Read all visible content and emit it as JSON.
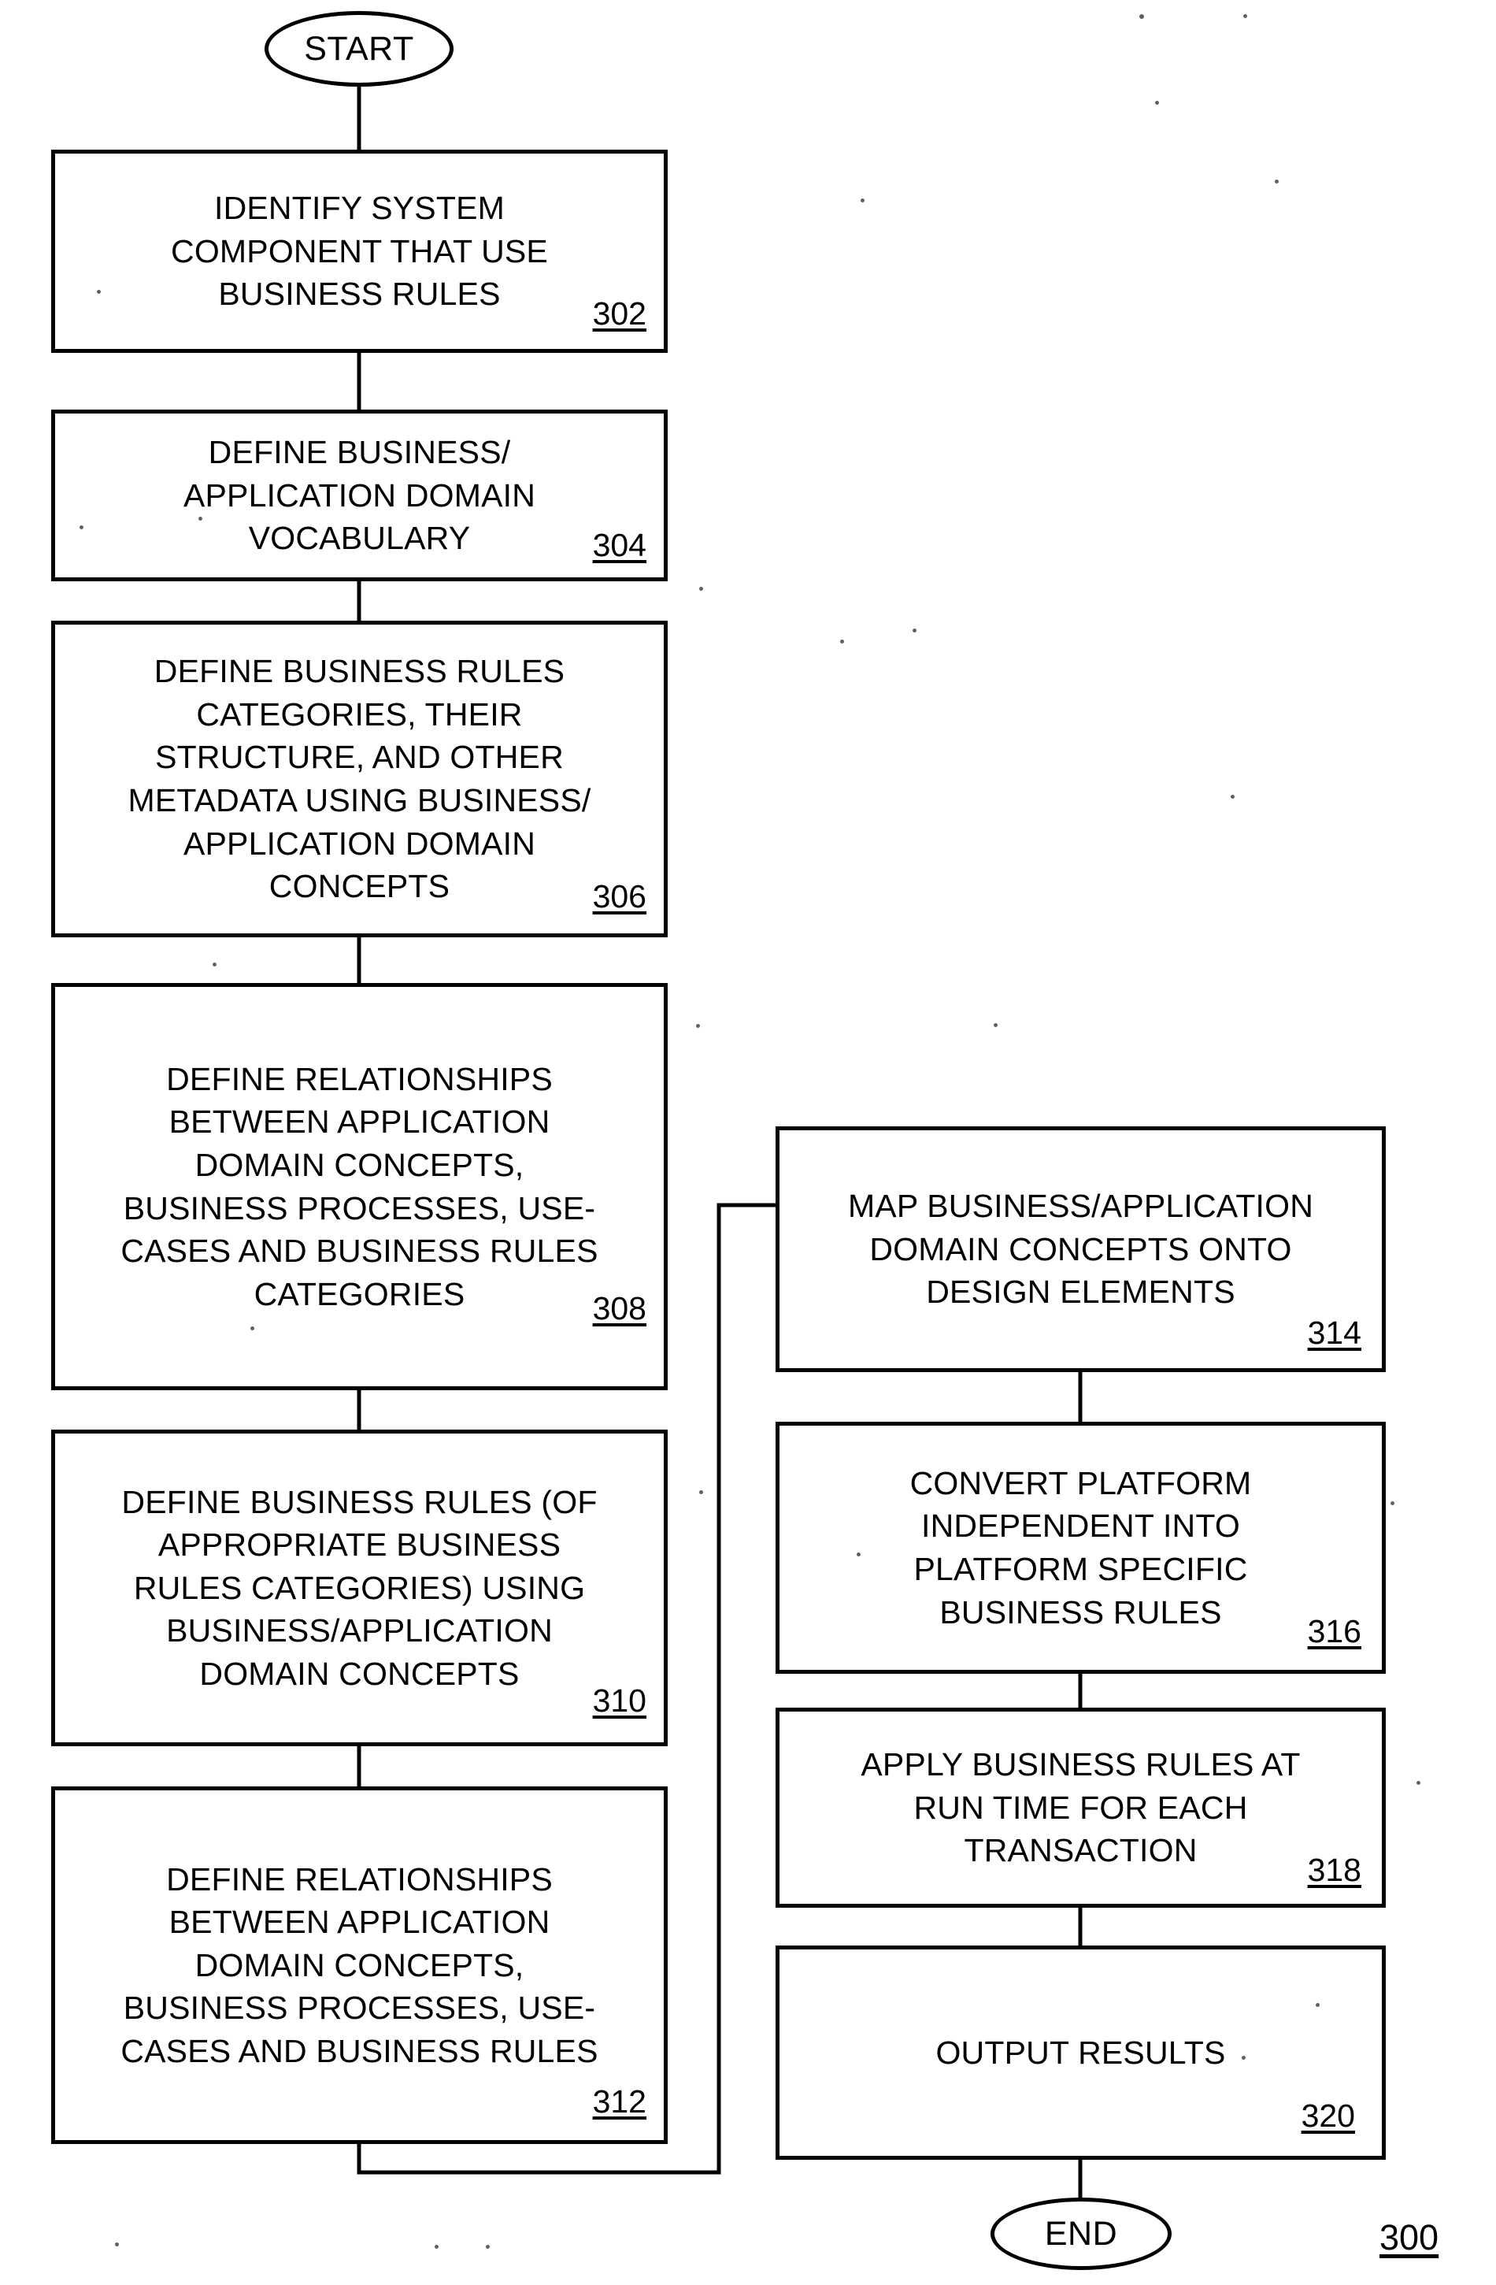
{
  "figure": {
    "number": "300",
    "start_label": "START",
    "end_label": "END"
  },
  "nodes": [
    {
      "id": "step-302",
      "ref": "302",
      "text": "IDENTIFY SYSTEM\nCOMPONENT THAT USE\nBUSINESS RULES",
      "column": "left"
    },
    {
      "id": "step-304",
      "ref": "304",
      "text": "DEFINE BUSINESS/\nAPPLICATION DOMAIN\nVOCABULARY",
      "column": "left"
    },
    {
      "id": "step-306",
      "ref": "306",
      "text": "DEFINE BUSINESS RULES\nCATEGORIES, THEIR\nSTRUCTURE, AND OTHER\nMETADATA USING BUSINESS/\nAPPLICATION DOMAIN\nCONCEPTS",
      "column": "left"
    },
    {
      "id": "step-308",
      "ref": "308",
      "text": "DEFINE RELATIONSHIPS\nBETWEEN APPLICATION\nDOMAIN CONCEPTS,\nBUSINESS PROCESSES, USE-\nCASES AND BUSINESS RULES\nCATEGORIES",
      "column": "left"
    },
    {
      "id": "step-310",
      "ref": "310",
      "text": "DEFINE BUSINESS RULES (OF\nAPPROPRIATE BUSINESS\nRULES CATEGORIES) USING\nBUSINESS/APPLICATION\nDOMAIN CONCEPTS",
      "column": "left"
    },
    {
      "id": "step-312",
      "ref": "312",
      "text": "DEFINE RELATIONSHIPS\nBETWEEN APPLICATION\nDOMAIN CONCEPTS,\nBUSINESS PROCESSES, USE-\nCASES AND BUSINESS RULES",
      "column": "left"
    },
    {
      "id": "step-314",
      "ref": "314",
      "text": "MAP BUSINESS/APPLICATION\nDOMAIN CONCEPTS ONTO\nDESIGN ELEMENTS",
      "column": "right"
    },
    {
      "id": "step-316",
      "ref": "316",
      "text": "CONVERT PLATFORM\nINDEPENDENT INTO\nPLATFORM SPECIFIC\nBUSINESS RULES",
      "column": "right"
    },
    {
      "id": "step-318",
      "ref": "318",
      "text": "APPLY BUSINESS RULES AT\nRUN TIME FOR EACH\nTRANSACTION",
      "column": "right"
    },
    {
      "id": "step-320",
      "ref": "320",
      "text": "OUTPUT RESULTS",
      "column": "right"
    }
  ],
  "colors": {
    "ink": "#000000",
    "paper": "#ffffff"
  }
}
